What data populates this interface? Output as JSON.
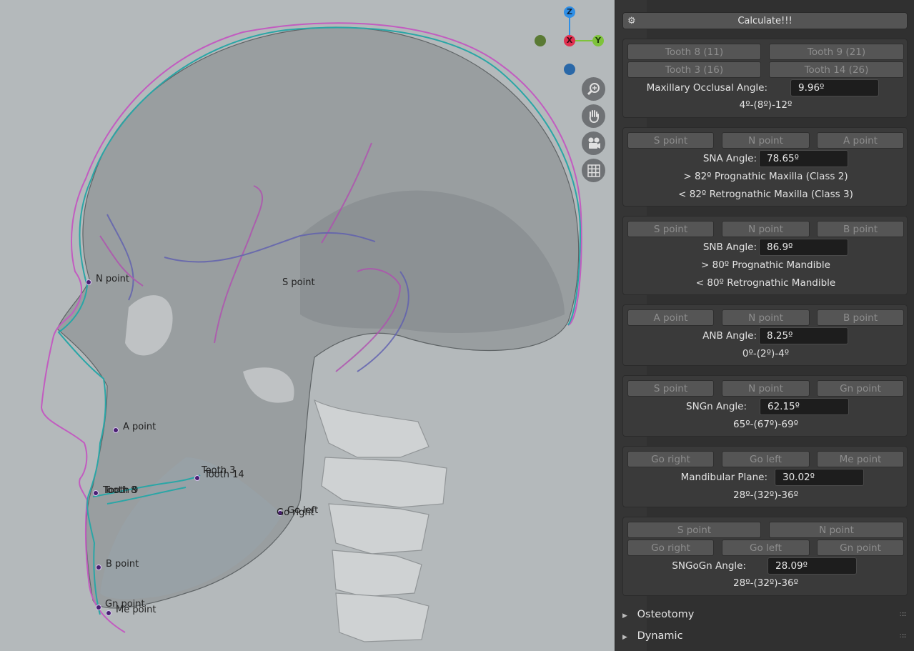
{
  "viewport": {
    "landmarks": [
      {
        "label": "N point"
      },
      {
        "label": "S point"
      },
      {
        "label": "A point"
      },
      {
        "label": "Tooth 3"
      },
      {
        "label": "Tooth 14"
      },
      {
        "label": "Tooth 8"
      },
      {
        "label": "Tooth 9"
      },
      {
        "label": "Go left"
      },
      {
        "label": "Go right"
      },
      {
        "label": "B point"
      },
      {
        "label": "Gn point"
      },
      {
        "label": "Me point"
      }
    ],
    "gizmo": {
      "z": "Z",
      "x": "X",
      "y": "Y"
    },
    "nav_icons": [
      "zoom-icon",
      "hand-pan-icon",
      "camera-icon",
      "grid-icon"
    ]
  },
  "sidebar": {
    "calculate_label": "Calculate!!!",
    "panels": [
      {
        "buttons": [
          "Tooth 8 (11)",
          "Tooth 9 (21)",
          "Tooth 3 (16)",
          "Tooth 14 (26)"
        ],
        "label": "Maxillary Occlusal Angle:",
        "value": "9.96º",
        "notes": [
          "4º-(8º)-12º"
        ]
      },
      {
        "buttons": [
          "S point",
          "N point",
          "A point"
        ],
        "label": "SNA Angle:",
        "value": "78.65º",
        "notes": [
          "> 82º Prognathic Maxilla (Class 2)",
          "< 82º Retrognathic Maxilla (Class 3)"
        ]
      },
      {
        "buttons": [
          "S point",
          "N point",
          "B point"
        ],
        "label": "SNB Angle:",
        "value": "86.9º",
        "notes": [
          "> 80º Prognathic Mandible",
          "< 80º Retrognathic Mandible"
        ]
      },
      {
        "buttons": [
          "A point",
          "N point",
          "B point"
        ],
        "label": "ANB Angle:",
        "value": "8.25º",
        "notes": [
          "0º-(2º)-4º"
        ]
      },
      {
        "buttons": [
          "S point",
          "N point",
          "Gn point"
        ],
        "label": "SNGn Angle:",
        "value": "62.15º",
        "notes": [
          "65º-(67º)-69º"
        ]
      },
      {
        "buttons": [
          "Go right",
          "Go left",
          "Me point"
        ],
        "label": "Mandibular Plane:",
        "value": "30.02º",
        "notes": [
          "28º-(32º)-36º"
        ]
      },
      {
        "buttons": [
          "S point",
          "N point",
          "Go right",
          "Go left",
          "Gn point"
        ],
        "label": "SNGoGn Angle:",
        "value": "28.09º",
        "notes": [
          "28º-(32º)-36º"
        ]
      }
    ],
    "collapsed_panels": [
      "Osteotomy",
      "Dynamic"
    ]
  },
  "colors": {
    "viewport_bg": "#b4b9bb",
    "soft_tissue_before": "#c25cc0",
    "soft_tissue_after": "#2aa6a6",
    "landmark_dot": "#4a1f73",
    "gizmo_x": "#e0304f",
    "gizmo_y": "#7ec33a",
    "gizmo_z": "#2f8fe6"
  }
}
